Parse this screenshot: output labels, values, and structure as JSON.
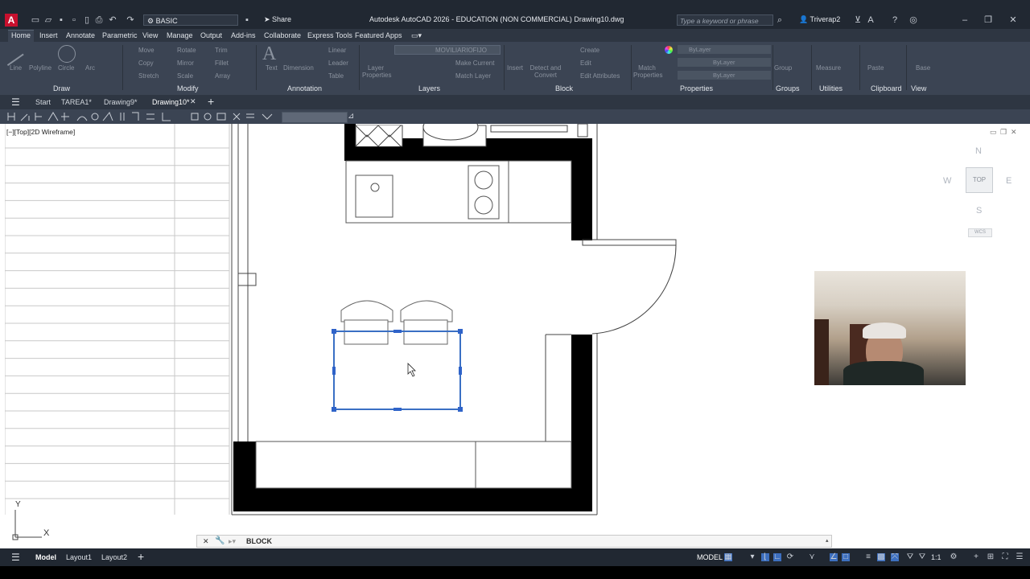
{
  "title_bar": {
    "window_title": "Autodesk AutoCAD 2026 - EDUCATION (NON COMMERCIAL)   Drawing10.dwg",
    "workspace": "BASIC",
    "share_label": "Share",
    "search_placeholder": "Type a keyword or phrase",
    "user_name": "Triverap2"
  },
  "ribbon_tabs": [
    "Home",
    "Insert",
    "Annotate",
    "Parametric",
    "View",
    "Manage",
    "Output",
    "Add-ins",
    "Collaborate",
    "Express Tools",
    "Featured Apps"
  ],
  "ribbon": {
    "draw": {
      "title": "Draw",
      "tools": [
        "Line",
        "Polyline",
        "Circle",
        "Arc"
      ]
    },
    "modify": {
      "title": "Modify",
      "tools": [
        "Move",
        "Rotate",
        "Trim",
        "Copy",
        "Mirror",
        "Fillet",
        "Stretch",
        "Scale",
        "Array"
      ]
    },
    "annotation": {
      "title": "Annotation",
      "tools": [
        "Text",
        "Dimension",
        "Linear",
        "Leader",
        "Table"
      ]
    },
    "layers": {
      "title": "Layers",
      "tools": [
        "Layer Properties",
        "Make Current",
        "Match Layer"
      ],
      "current_layer": "MOVILIARIOFIJO"
    },
    "block": {
      "title": "Block",
      "tools": [
        "Insert",
        "Detect and Convert",
        "Create",
        "Edit",
        "Edit Attributes"
      ]
    },
    "properties": {
      "title": "Properties",
      "tools": [
        "Match Properties"
      ],
      "values": [
        "ByLayer",
        "ByLayer",
        "ByLayer"
      ]
    },
    "groups": {
      "title": "Groups",
      "tools": [
        "Group"
      ]
    },
    "utilities": {
      "title": "Utilities",
      "tools": [
        "Measure"
      ]
    },
    "clipboard": {
      "title": "Clipboard",
      "tools": [
        "Paste"
      ]
    },
    "view": {
      "title": "View",
      "tools": [
        "Base"
      ]
    }
  },
  "doc_tabs": [
    "Start",
    "TAREA1*",
    "Drawing9*",
    "Drawing10*"
  ],
  "viewport_label": "[−][Top][2D Wireframe]",
  "view_cube": {
    "north": "N",
    "south": "S",
    "east": "E",
    "west": "W",
    "face": "TOP",
    "ucs": "WCS"
  },
  "ucs_icon": {
    "x": "X",
    "y": "Y"
  },
  "command_line": {
    "text": "BLOCK"
  },
  "status_bar": {
    "layout_tabs": [
      "Model",
      "Layout1",
      "Layout2"
    ],
    "space": "MODEL",
    "annotation_scale": "1:1"
  },
  "colors": {
    "accent": "#3d6fbf",
    "logo": "#c8102e",
    "title_bg": "#212832",
    "ribbon_bg": "#3b4453"
  }
}
